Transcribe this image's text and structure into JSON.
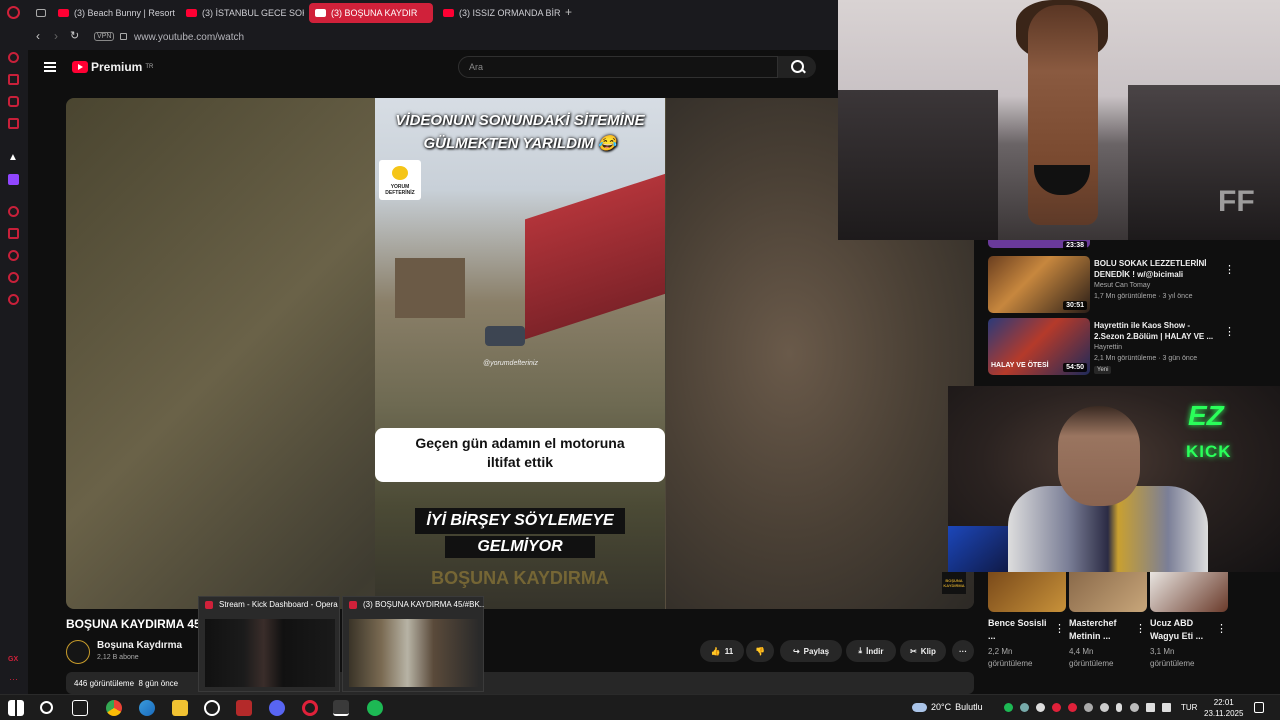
{
  "browser": {
    "tabs": [
      {
        "label": "(3) Beach Bunny | Resort"
      },
      {
        "label": "(3) İSTANBUL GECE SOK"
      },
      {
        "label": "(3) BOŞUNA KAYDIR"
      },
      {
        "label": "(3) ISSIZ ORMANDA BİR O"
      }
    ],
    "vpn": "VPN",
    "url": "www.youtube.com/watch"
  },
  "youtube": {
    "logo_text": "Premium",
    "logo_region": "TR",
    "search_placeholder": "Ara"
  },
  "video": {
    "clip_top_line1": "VİDEONUN SONUNDAKİ SİTEMİNE",
    "clip_top_line2": "GÜLMEKTEN YARILDIM 😂",
    "clip_logo": "YORUM DEFTERİNİZ",
    "clip_watermark": "@yorumdefteriniz",
    "clip_caption_line1": "Geçen gün adamın el motoruna",
    "clip_caption_line2": "iltifat ettik",
    "clip_bottom_line1": "İYİ BİRŞEY SÖYLEMEYE",
    "clip_bottom_line2": "GELMİYOR",
    "clip_ghost": "BOŞUNA KAYDIRMA",
    "channel_bug": "BOŞUNA KAYDIRMA",
    "title": "BOŞUNA KAYDIRMA 45/",
    "channel_name": "Boşuna Kaydırma",
    "subscribers": "2,12 B abone",
    "views": "446 görüntüleme",
    "age": "8 gün önce",
    "likes": "11",
    "share_label": "Paylaş",
    "download_label": "İndir",
    "clip_label": "Klip"
  },
  "previews": [
    {
      "title": "Stream - Kick Dashboard - Opera"
    },
    {
      "title": "(3) BOŞUNA KAYDIRMA 45/#BK..."
    }
  ],
  "recommended": [
    {
      "duration": "23:38"
    },
    {
      "title": "BOLU SOKAK LEZZETLERİNİ DENEDİK ! w/@bicimali",
      "channel": "Mesut Can Tomay",
      "views": "1,7 Mn görüntüleme",
      "age": "3 yıl önce",
      "duration": "30:51"
    },
    {
      "title": "Hayrettin ile Kaos Show - 2.Sezon 2.Bölüm | HALAY VE ...",
      "channel": "Hayrettin",
      "views": "2,1 Mn görüntüleme",
      "age": "3 gün önce",
      "badge": "Yeni",
      "duration": "54:50",
      "thumb_text": "HALAY VE ÖTESİ"
    }
  ],
  "webcam": {
    "ez": "EZ",
    "kick": "KICK"
  },
  "runway": {
    "watermark": "FF"
  },
  "shorts": [
    {
      "title": "Bence Sosisli ...",
      "views": "2,2 Mn",
      "views_label": "görüntüleme"
    },
    {
      "title": "Masterchef Metinin ...",
      "views": "4,4 Mn",
      "views_label": "görüntüleme"
    },
    {
      "title": "Ucuz ABD Wagyu Eti ...",
      "views": "3,1 Mn",
      "views_label": "görüntüleme"
    }
  ],
  "taskbar": {
    "temperature": "20°C",
    "weather": "Bulutlu",
    "language": "TUR",
    "time": "22:01",
    "date": "23.11.2025"
  },
  "colors": {
    "accent": "#ff0033",
    "opera_red": "#d0213a",
    "kick_green": "#2aff5a"
  }
}
